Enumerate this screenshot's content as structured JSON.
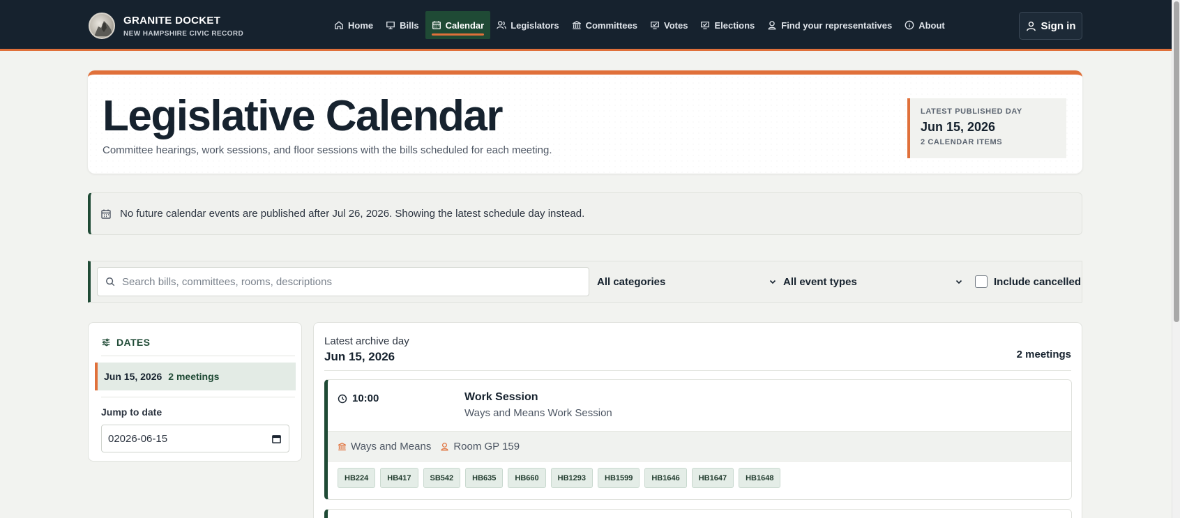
{
  "brand": {
    "name": "GRANITE DOCKET",
    "subtitle": "NEW HAMPSHIRE CIVIC RECORD"
  },
  "nav": {
    "items": [
      {
        "label": "Home",
        "icon": "home-icon"
      },
      {
        "label": "Bills",
        "icon": "bill-icon"
      },
      {
        "label": "Calendar",
        "icon": "calendar-icon",
        "active": true
      },
      {
        "label": "Legislators",
        "icon": "people-icon"
      },
      {
        "label": "Committees",
        "icon": "building-icon"
      },
      {
        "label": "Votes",
        "icon": "vote-icon"
      },
      {
        "label": "Elections",
        "icon": "ballot-icon"
      },
      {
        "label": "Find your representatives",
        "icon": "location-person-icon"
      },
      {
        "label": "About",
        "icon": "info-icon"
      }
    ],
    "sign_in": "Sign in"
  },
  "hero": {
    "title": "Legislative Calendar",
    "description": "Committee hearings, work sessions, and floor sessions with the bills scheduled for each meeting.",
    "latest_label": "LATEST PUBLISHED DAY",
    "latest_date": "Jun 15, 2026",
    "latest_count": "2 CALENDAR ITEMS"
  },
  "notice": {
    "text": "No future calendar events are published after Jul 26, 2026. Showing the latest schedule day instead."
  },
  "filters": {
    "search_placeholder": "Search bills, committees, rooms, descriptions",
    "category": "All categories",
    "event_type": "All event types",
    "include_cancelled": "Include cancelled"
  },
  "dates": {
    "heading": "DATES",
    "items": [
      {
        "date": "Jun 15, 2026",
        "count": "2 meetings"
      }
    ],
    "jump_label": "Jump to date",
    "jump_value": "02026-06-15"
  },
  "main": {
    "archive_label": "Latest archive day",
    "archive_date": "Jun 15, 2026",
    "meetings_count": "2 meetings",
    "events": [
      {
        "time": "10:00",
        "title": "Work Session",
        "subtitle": "Ways and Means Work Session",
        "committee": "Ways and Means",
        "room": "Room GP 159",
        "bills": [
          "HB224",
          "HB417",
          "SB542",
          "HB635",
          "HB660",
          "HB1293",
          "HB1599",
          "HB1646",
          "HB1647",
          "HB1648"
        ]
      }
    ]
  },
  "colors": {
    "nav_bg": "#16222e",
    "accent_orange": "#e0703a",
    "accent_green": "#1f4a35"
  }
}
